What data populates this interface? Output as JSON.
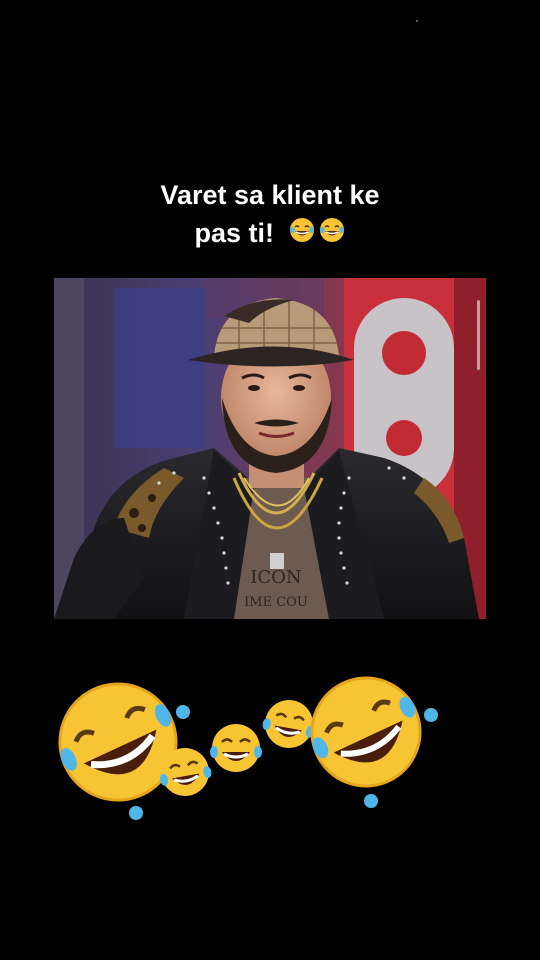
{
  "caption": {
    "line1": "Varet sa klient ke",
    "line2": "pas ti!",
    "emoji_icons": [
      "face-with-tears-of-joy-icon",
      "face-with-tears-of-joy-icon"
    ]
  },
  "video": {
    "subject": "man-in-plaid-cap-and-studded-leather-jacket",
    "shirt_text_line1": "ICON",
    "shirt_text_line2": "IME COU"
  },
  "sticker": {
    "icons": [
      "rolling-on-floor-laughing-icon",
      "face-with-tears-of-joy-icon",
      "face-with-tears-of-joy-icon",
      "face-with-tears-of-joy-icon",
      "rolling-on-floor-laughing-icon"
    ]
  },
  "colors": {
    "background": "#000000",
    "caption_text": "#ffffff",
    "emoji_yellow": "#f7c534",
    "tear_blue": "#4fb6e8"
  }
}
